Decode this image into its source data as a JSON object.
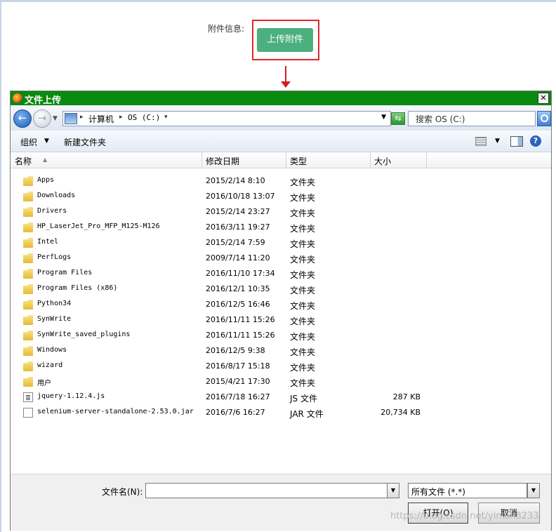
{
  "page": {
    "attach_label": "附件信息:",
    "upload_button": "上传附件"
  },
  "dialog": {
    "title": "文件上传",
    "close": "✕",
    "address": [
      "计算机",
      "OS (C:)"
    ],
    "search_placeholder": "搜索 OS (C:)",
    "toolbar": {
      "organize": "组织",
      "new_folder": "新建文件夹"
    },
    "columns": [
      "名称",
      "修改日期",
      "类型",
      "大小"
    ],
    "files": [
      {
        "name": "Apps",
        "date": "2015/2/14 8:10",
        "type": "文件夹",
        "size": "",
        "icon": "folder-icon"
      },
      {
        "name": "Downloads",
        "date": "2016/10/18 13:07",
        "type": "文件夹",
        "size": "",
        "icon": "folder-icon"
      },
      {
        "name": "Drivers",
        "date": "2015/2/14 23:27",
        "type": "文件夹",
        "size": "",
        "icon": "folder-icon"
      },
      {
        "name": "HP_LaserJet_Pro_MFP_M125-M126",
        "date": "2016/3/11 19:27",
        "type": "文件夹",
        "size": "",
        "icon": "folder-icon"
      },
      {
        "name": "Intel",
        "date": "2015/2/14 7:59",
        "type": "文件夹",
        "size": "",
        "icon": "folder-icon"
      },
      {
        "name": "PerfLogs",
        "date": "2009/7/14 11:20",
        "type": "文件夹",
        "size": "",
        "icon": "folder-icon"
      },
      {
        "name": "Program Files",
        "date": "2016/11/10 17:34",
        "type": "文件夹",
        "size": "",
        "icon": "folder-icon"
      },
      {
        "name": "Program Files (x86)",
        "date": "2016/12/1 10:35",
        "type": "文件夹",
        "size": "",
        "icon": "folder-icon"
      },
      {
        "name": "Python34",
        "date": "2016/12/5 16:46",
        "type": "文件夹",
        "size": "",
        "icon": "folder-icon"
      },
      {
        "name": "SynWrite",
        "date": "2016/11/11 15:26",
        "type": "文件夹",
        "size": "",
        "icon": "folder-icon"
      },
      {
        "name": "SynWrite_saved_plugins",
        "date": "2016/11/11 15:26",
        "type": "文件夹",
        "size": "",
        "icon": "folder-icon"
      },
      {
        "name": "Windows",
        "date": "2016/12/5 9:38",
        "type": "文件夹",
        "size": "",
        "icon": "folder-icon"
      },
      {
        "name": "wizard",
        "date": "2016/8/17 15:18",
        "type": "文件夹",
        "size": "",
        "icon": "folder-icon"
      },
      {
        "name": "用户",
        "date": "2015/4/21 17:30",
        "type": "文件夹",
        "size": "",
        "icon": "folder-icon"
      },
      {
        "name": "jquery-1.12.4.js",
        "date": "2016/7/18 16:27",
        "type": "JS 文件",
        "size": "287 KB",
        "icon": "js-file-icon"
      },
      {
        "name": "selenium-server-standalone-2.53.0.jar",
        "date": "2016/7/6 16:27",
        "type": "JAR 文件",
        "size": "20,734 KB",
        "icon": "jar-file-icon"
      }
    ],
    "filename_label": "文件名(N):",
    "filename_value": "",
    "filetype": "所有文件 (*.*)",
    "open_button": "打开(O)",
    "cancel_button": "取消"
  },
  "watermark": "https://blog.csdn.net/yinlan8233"
}
